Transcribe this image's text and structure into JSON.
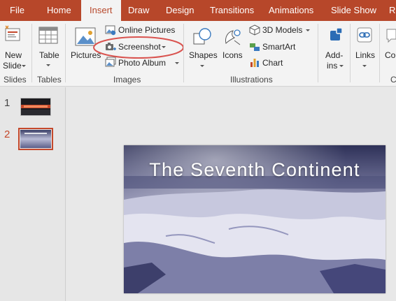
{
  "tabs": {
    "file": "File",
    "home": "Home",
    "insert": "Insert",
    "draw": "Draw",
    "design": "Design",
    "transitions": "Transitions",
    "animations": "Animations",
    "slideshow": "Slide Show",
    "review": "R"
  },
  "ribbon": {
    "slides": {
      "new_slide_line1": "New",
      "new_slide_line2": "Slide",
      "label": "Slides"
    },
    "tables": {
      "table": "Table",
      "label": "Tables"
    },
    "images": {
      "pictures": "Pictures",
      "online_pictures": "Online Pictures",
      "screenshot": "Screenshot",
      "photo_album": "Photo Album",
      "label": "Images"
    },
    "illustrations": {
      "shapes": "Shapes",
      "icons": "Icons",
      "models_3d": "3D Models",
      "smartart": "SmartArt",
      "chart": "Chart",
      "label": "Illustrations"
    },
    "addins": {
      "line1": "Add-",
      "line2": "ins"
    },
    "links": {
      "label": "Links"
    },
    "comments": {
      "partial": "Co",
      "label_partial": "C"
    }
  },
  "thumbnails": [
    {
      "number": "1"
    },
    {
      "number": "2"
    }
  ],
  "slide": {
    "title": "The Seventh Continent"
  },
  "colors": {
    "accent": "#b7472a",
    "highlight_ring": "#d9534f"
  }
}
